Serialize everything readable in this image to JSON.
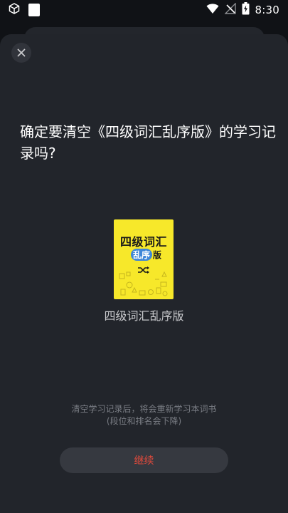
{
  "status_bar": {
    "time": "8:30",
    "icons": [
      "cube-icon",
      "square-icon",
      "wifi-icon",
      "no-signal-icon",
      "battery-charging-icon"
    ]
  },
  "dialog": {
    "close_icon": "close-icon",
    "question": "确定要清空《四级词汇乱序版》的学习记录吗?",
    "book": {
      "cover_title": "四级词汇",
      "cover_sub_highlight": "乱序",
      "cover_sub_rest": "版",
      "cover_icon": "shuffle-icon",
      "name": "四级词汇乱序版"
    },
    "hint_line1": "清空学习记录后，将会重新学习本词书",
    "hint_line2": "(段位和排名会下降)",
    "continue_label": "继续"
  },
  "colors": {
    "background": "#101216",
    "sheet": "#22252b",
    "button": "#363940",
    "button_text": "#e04a3c",
    "cover": "#f7e82a",
    "cover_pill": "#3f86d8"
  }
}
